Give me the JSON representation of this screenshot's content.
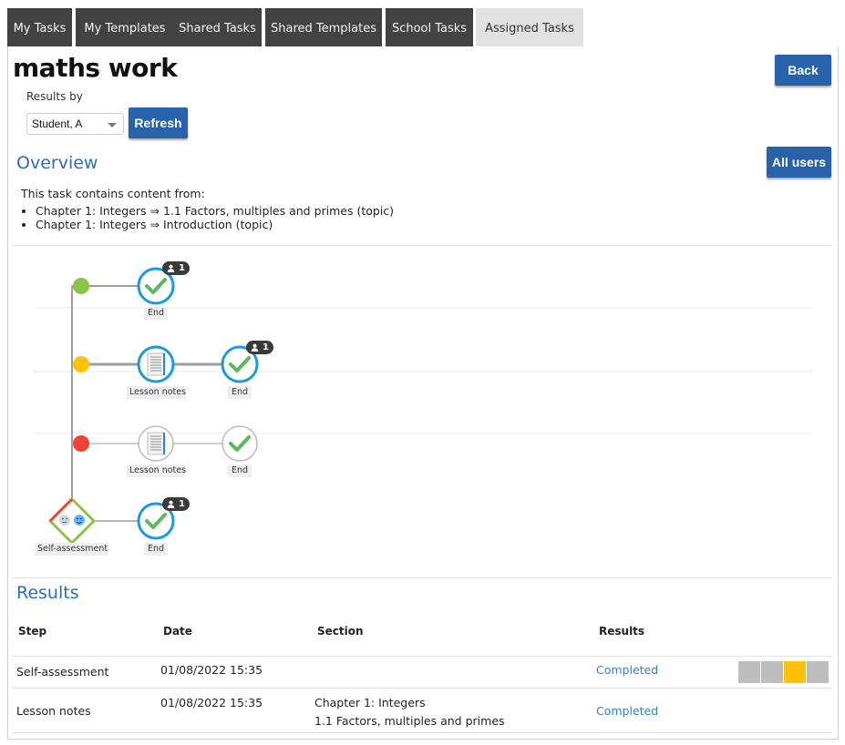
{
  "tabs": [
    {
      "label": "My Tasks",
      "active": false
    },
    {
      "label": "My Templates",
      "active": false
    },
    {
      "label": "Shared Tasks",
      "active": false
    },
    {
      "label": "Shared Templates",
      "active": false
    },
    {
      "label": "School Tasks",
      "active": false
    },
    {
      "label": "Assigned Tasks",
      "active": true
    }
  ],
  "header": {
    "title": "maths work",
    "back_label": "Back"
  },
  "filter": {
    "results_by_label": "Results by",
    "selected_student": "Student, A",
    "refresh_label": "Refresh"
  },
  "overview": {
    "heading": "Overview",
    "all_users_label": "All users",
    "intro": "This task contains content from:",
    "items": [
      "Chapter 1: Integers ⇒ 1.1 Factors, multiples and primes (topic)",
      "Chapter 1: Integers ⇒ Introduction (topic)"
    ]
  },
  "diagram": {
    "colors": {
      "green": "#8bc34a",
      "amber": "#ffc107",
      "red": "#f44336",
      "blue": "#1e9bd7",
      "check": "#5cb85c"
    },
    "branches": [
      {
        "dot_color": "green",
        "nodes": [
          {
            "type": "end",
            "label": "End",
            "completed": true,
            "users": "1"
          }
        ]
      },
      {
        "dot_color": "amber",
        "nodes": [
          {
            "type": "lesson-notes",
            "label": "Lesson notes",
            "completed": true
          },
          {
            "type": "end",
            "label": "End",
            "completed": true,
            "users": "1"
          }
        ]
      },
      {
        "dot_color": "red",
        "nodes": [
          {
            "type": "lesson-notes",
            "label": "Lesson notes",
            "completed": false
          },
          {
            "type": "end",
            "label": "End",
            "completed": false
          }
        ]
      },
      {
        "dot_color": "none",
        "nodes": [
          {
            "type": "self-assessment",
            "label": "Self-assessment"
          },
          {
            "type": "end",
            "label": "End",
            "completed": true,
            "users": "1"
          }
        ]
      }
    ]
  },
  "results": {
    "heading": "Results",
    "columns": [
      "Step",
      "Date",
      "Section",
      "Results"
    ],
    "rows": [
      {
        "step": "Self-assessment",
        "date": "01/08/2022 15:35",
        "section_line1": "",
        "section_line2": "",
        "result": "Completed",
        "rating_selected_index": 2,
        "rating_count": 4
      },
      {
        "step": "Lesson notes",
        "date": "01/08/2022 15:35",
        "section_line1": "Chapter 1: Integers",
        "section_line2": "1.1 Factors, multiples and primes",
        "result": "Completed"
      }
    ],
    "rating_colors": {
      "off": "#bdbdbd",
      "on": "#ffc107"
    }
  }
}
